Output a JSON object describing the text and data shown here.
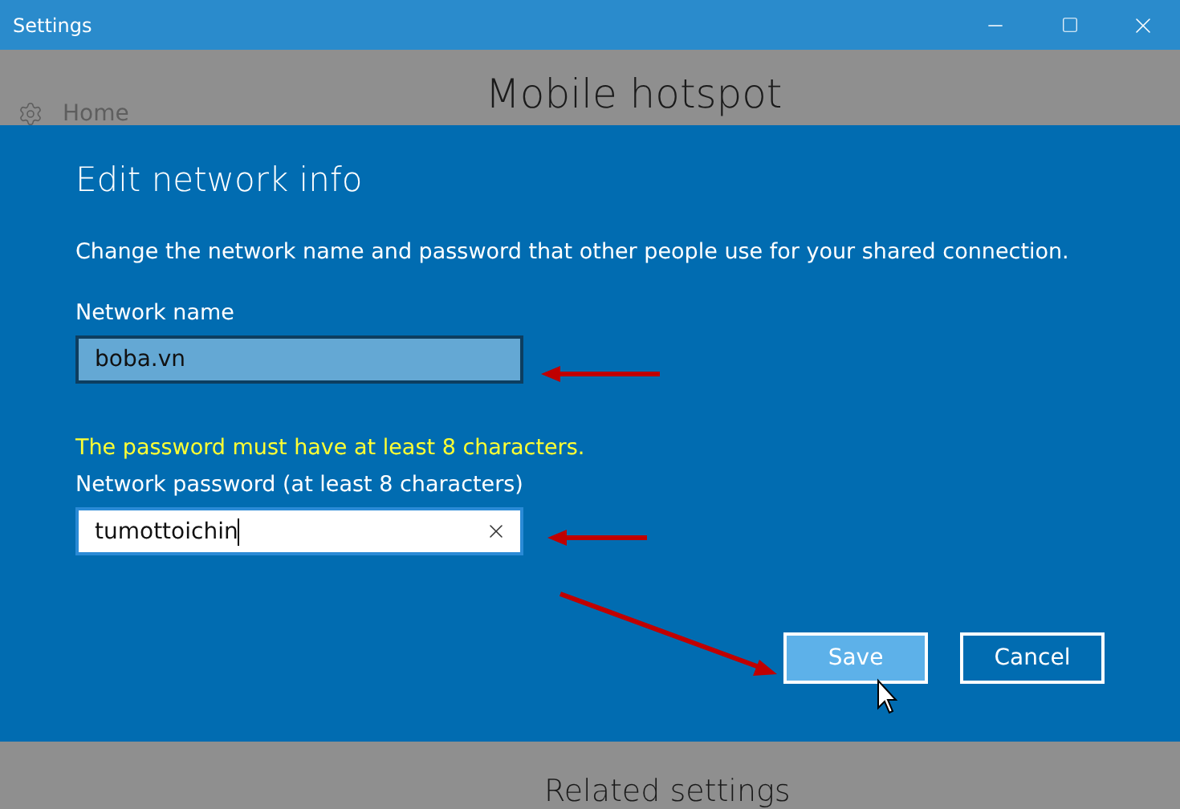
{
  "window": {
    "title": "Settings"
  },
  "sidebar": {
    "items": [
      {
        "label": "Home"
      }
    ]
  },
  "page": {
    "title": "Mobile hotspot",
    "section_title": "Related settings"
  },
  "dialog": {
    "title": "Edit network info",
    "description": "Change the network name and password that other people use for your shared connection.",
    "fields": [
      {
        "label": "Network name",
        "value": "boba.vn",
        "focused": false
      },
      {
        "label": "Network password (at least 8 characters)",
        "value": "tumottoichin",
        "focused": true,
        "error": "The password must have at least 8 characters."
      }
    ],
    "buttons": [
      {
        "label": "Save",
        "hovered": true
      },
      {
        "label": "Cancel",
        "hovered": false
      }
    ]
  }
}
